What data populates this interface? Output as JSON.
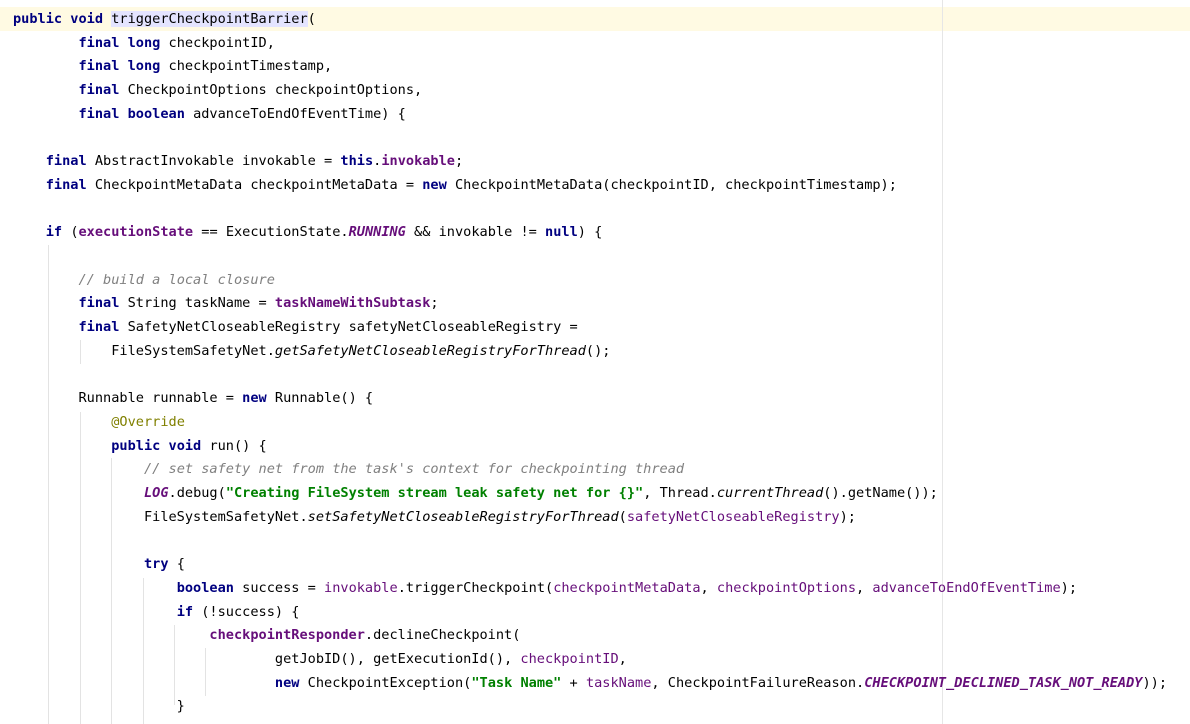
{
  "editor": {
    "lines": [
      [
        {
          "t": "public void ",
          "c": "kw"
        },
        {
          "t": "triggerCheckpointBarrier",
          "c": "mdecl"
        },
        {
          "t": "("
        }
      ],
      [
        {
          "t": "        "
        },
        {
          "t": "final long ",
          "c": "kw"
        },
        {
          "t": "checkpointID,"
        }
      ],
      [
        {
          "t": "        "
        },
        {
          "t": "final long ",
          "c": "kw"
        },
        {
          "t": "checkpointTimestamp,"
        }
      ],
      [
        {
          "t": "        "
        },
        {
          "t": "final ",
          "c": "kw"
        },
        {
          "t": "CheckpointOptions checkpointOptions,"
        }
      ],
      [
        {
          "t": "        "
        },
        {
          "t": "final boolean ",
          "c": "kw"
        },
        {
          "t": "advanceToEndOfEventTime) {"
        }
      ],
      [],
      [
        {
          "t": "    "
        },
        {
          "t": "final ",
          "c": "kw"
        },
        {
          "t": "AbstractInvokable invokable = "
        },
        {
          "t": "this",
          "c": "kw"
        },
        {
          "t": "."
        },
        {
          "t": "invokable",
          "c": "fld"
        },
        {
          "t": ";"
        }
      ],
      [
        {
          "t": "    "
        },
        {
          "t": "final ",
          "c": "kw"
        },
        {
          "t": "CheckpointMetaData checkpointMetaData = "
        },
        {
          "t": "new ",
          "c": "kw"
        },
        {
          "t": "CheckpointMetaData(checkpointID, checkpointTimestamp);"
        }
      ],
      [],
      [
        {
          "t": "    "
        },
        {
          "t": "if ",
          "c": "kw"
        },
        {
          "t": "("
        },
        {
          "t": "executionState",
          "c": "fld"
        },
        {
          "t": " == ExecutionState."
        },
        {
          "t": "RUNNING",
          "c": "const"
        },
        {
          "t": " && invokable != "
        },
        {
          "t": "null",
          "c": "kw"
        },
        {
          "t": ") {"
        }
      ],
      [],
      [
        {
          "t": "        "
        },
        {
          "t": "// build a local closure",
          "c": "cmt"
        }
      ],
      [
        {
          "t": "        "
        },
        {
          "t": "final ",
          "c": "kw"
        },
        {
          "t": "String taskName = "
        },
        {
          "t": "taskNameWithSubtask",
          "c": "fld"
        },
        {
          "t": ";"
        }
      ],
      [
        {
          "t": "        "
        },
        {
          "t": "final ",
          "c": "kw"
        },
        {
          "t": "SafetyNetCloseableRegistry safetyNetCloseableRegistry ="
        }
      ],
      [
        {
          "t": "            FileSystemSafetyNet."
        },
        {
          "t": "getSafetyNetCloseableRegistryForThread",
          "c": "st"
        },
        {
          "t": "();"
        }
      ],
      [],
      [
        {
          "t": "        Runnable runnable = "
        },
        {
          "t": "new ",
          "c": "kw"
        },
        {
          "t": "Runnable() {"
        }
      ],
      [
        {
          "t": "            "
        },
        {
          "t": "@Override",
          "c": "ann"
        }
      ],
      [
        {
          "t": "            "
        },
        {
          "t": "public void ",
          "c": "kw"
        },
        {
          "t": "run() {"
        }
      ],
      [
        {
          "t": "                "
        },
        {
          "t": "// set safety net from the task's context for checkpointing thread",
          "c": "cmt"
        }
      ],
      [
        {
          "t": "                "
        },
        {
          "t": "LOG",
          "c": "const"
        },
        {
          "t": ".debug("
        },
        {
          "t": "\"Creating FileSystem stream leak safety net for {}\"",
          "c": "str"
        },
        {
          "t": ", Thread."
        },
        {
          "t": "currentThread",
          "c": "st"
        },
        {
          "t": "().getName());"
        }
      ],
      [
        {
          "t": "                FileSystemSafetyNet."
        },
        {
          "t": "setSafetyNetCloseableRegistryForThread",
          "c": "st"
        },
        {
          "t": "("
        },
        {
          "t": "safetyNetCloseableRegistry",
          "c": "fldn"
        },
        {
          "t": ");"
        }
      ],
      [],
      [
        {
          "t": "                "
        },
        {
          "t": "try ",
          "c": "kw"
        },
        {
          "t": "{"
        }
      ],
      [
        {
          "t": "                    "
        },
        {
          "t": "boolean ",
          "c": "kw"
        },
        {
          "t": "success = "
        },
        {
          "t": "invokable",
          "c": "fldn"
        },
        {
          "t": ".triggerCheckpoint("
        },
        {
          "t": "checkpointMetaData",
          "c": "fldn"
        },
        {
          "t": ", "
        },
        {
          "t": "checkpointOptions",
          "c": "fldn"
        },
        {
          "t": ", "
        },
        {
          "t": "advanceToEndOfEventTime",
          "c": "fldn"
        },
        {
          "t": ");"
        }
      ],
      [
        {
          "t": "                    "
        },
        {
          "t": "if ",
          "c": "kw"
        },
        {
          "t": "(!success) {"
        }
      ],
      [
        {
          "t": "                        "
        },
        {
          "t": "checkpointResponder",
          "c": "fld"
        },
        {
          "t": ".declineCheckpoint("
        }
      ],
      [
        {
          "t": "                                getJobID(), getExecutionId(), "
        },
        {
          "t": "checkpointID",
          "c": "fldn"
        },
        {
          "t": ","
        }
      ],
      [
        {
          "t": "                                "
        },
        {
          "t": "new ",
          "c": "kw"
        },
        {
          "t": "CheckpointException("
        },
        {
          "t": "\"Task Name\"",
          "c": "str"
        },
        {
          "t": " + "
        },
        {
          "t": "taskName",
          "c": "fldn"
        },
        {
          "t": ", CheckpointFailureReason."
        },
        {
          "t": "CHECKPOINT_DECLINED_TASK_NOT_READY",
          "c": "const"
        },
        {
          "t": "));"
        }
      ],
      [
        {
          "t": "                    }"
        }
      ]
    ]
  }
}
